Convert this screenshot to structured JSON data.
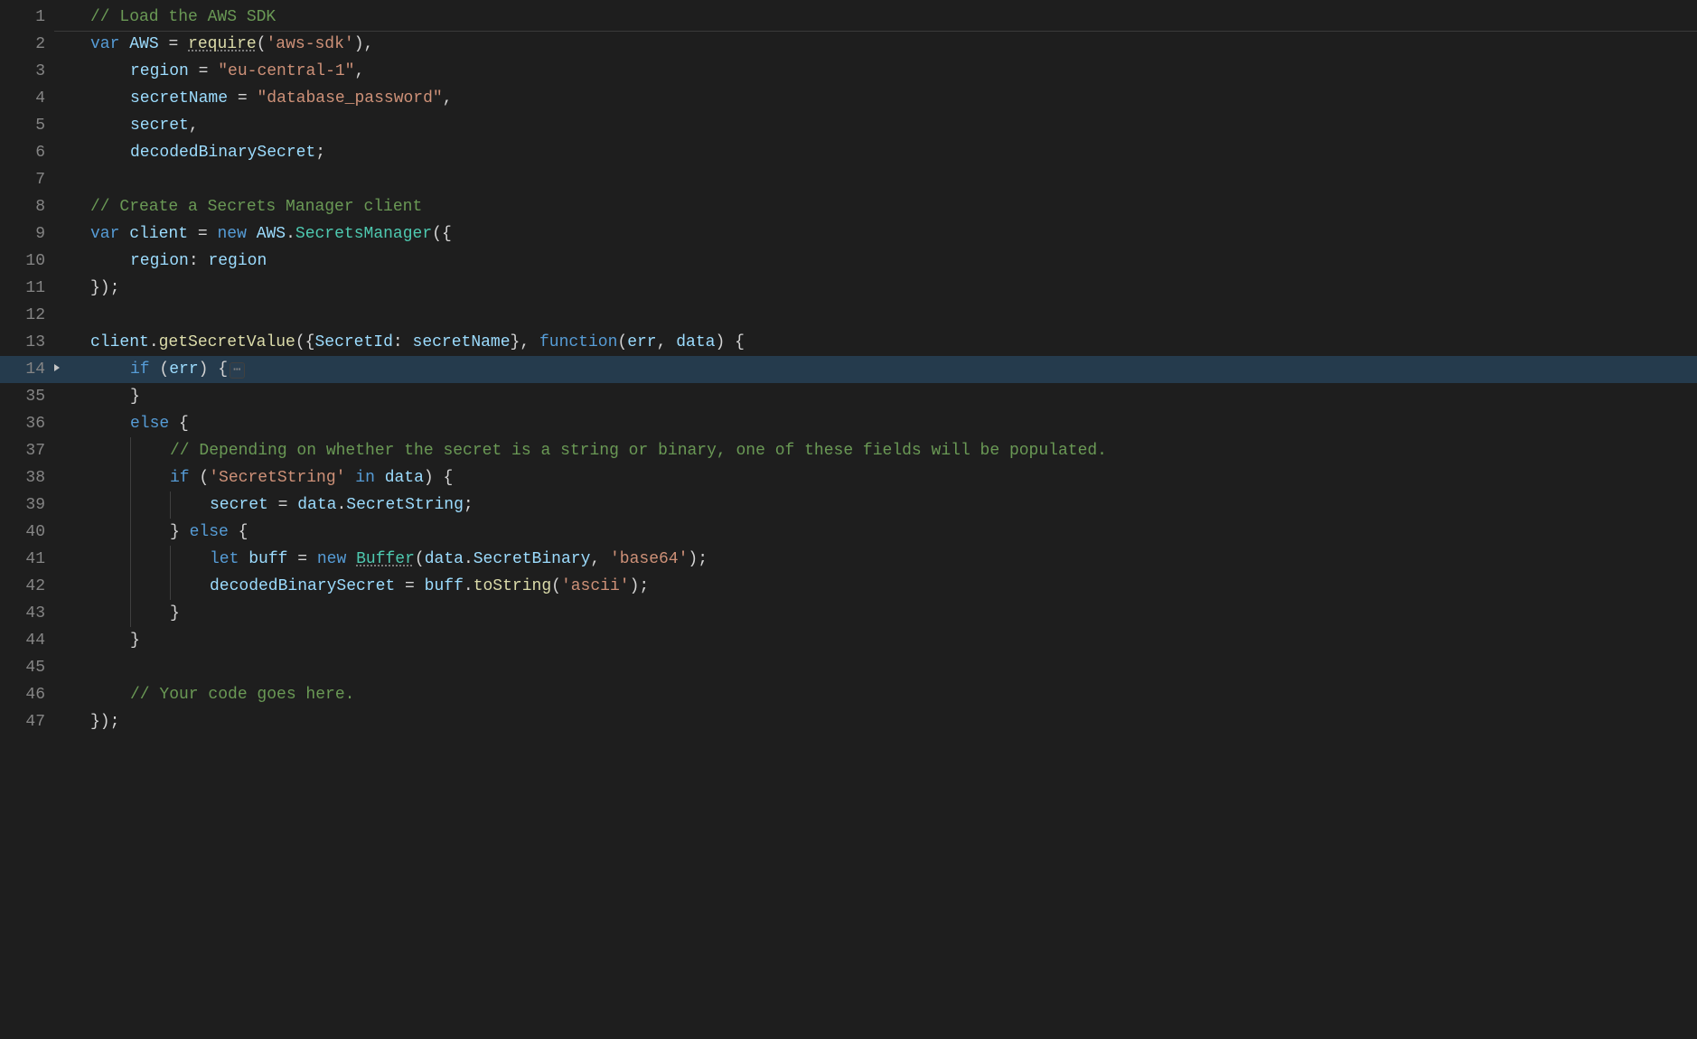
{
  "editor": {
    "highlighted_line_display_number": "14",
    "fold_icon_line_display_number": "14",
    "lines": [
      {
        "n": "1",
        "indent": 0,
        "tokens": [
          {
            "c": "tok-comment",
            "t": "// Load the AWS SDK"
          }
        ]
      },
      {
        "n": "2",
        "indent": 0,
        "tokens": [
          {
            "c": "tok-keyword",
            "t": "var"
          },
          {
            "c": "tok-def",
            "t": " "
          },
          {
            "c": "tok-var",
            "t": "AWS"
          },
          {
            "c": "tok-def",
            "t": " "
          },
          {
            "c": "tok-op",
            "t": "="
          },
          {
            "c": "tok-def",
            "t": " "
          },
          {
            "c": "tok-func underline",
            "t": "require"
          },
          {
            "c": "tok-punc",
            "t": "("
          },
          {
            "c": "tok-string",
            "t": "'aws-sdk'"
          },
          {
            "c": "tok-punc",
            "t": "),"
          }
        ]
      },
      {
        "n": "3",
        "indent": 1,
        "tokens": [
          {
            "c": "tok-var",
            "t": "region"
          },
          {
            "c": "tok-def",
            "t": " "
          },
          {
            "c": "tok-op",
            "t": "="
          },
          {
            "c": "tok-def",
            "t": " "
          },
          {
            "c": "tok-string",
            "t": "\"eu-central-1\""
          },
          {
            "c": "tok-punc",
            "t": ","
          }
        ]
      },
      {
        "n": "4",
        "indent": 1,
        "tokens": [
          {
            "c": "tok-var",
            "t": "secretName"
          },
          {
            "c": "tok-def",
            "t": " "
          },
          {
            "c": "tok-op",
            "t": "="
          },
          {
            "c": "tok-def",
            "t": " "
          },
          {
            "c": "tok-string",
            "t": "\"database_password\""
          },
          {
            "c": "tok-punc",
            "t": ","
          }
        ]
      },
      {
        "n": "5",
        "indent": 1,
        "tokens": [
          {
            "c": "tok-var",
            "t": "secret"
          },
          {
            "c": "tok-punc",
            "t": ","
          }
        ]
      },
      {
        "n": "6",
        "indent": 1,
        "tokens": [
          {
            "c": "tok-var",
            "t": "decodedBinarySecret"
          },
          {
            "c": "tok-punc",
            "t": ";"
          }
        ]
      },
      {
        "n": "7",
        "indent": 0,
        "tokens": []
      },
      {
        "n": "8",
        "indent": 0,
        "tokens": [
          {
            "c": "tok-comment",
            "t": "// Create a Secrets Manager client"
          }
        ]
      },
      {
        "n": "9",
        "indent": 0,
        "tokens": [
          {
            "c": "tok-keyword",
            "t": "var"
          },
          {
            "c": "tok-def",
            "t": " "
          },
          {
            "c": "tok-var",
            "t": "client"
          },
          {
            "c": "tok-def",
            "t": " "
          },
          {
            "c": "tok-op",
            "t": "="
          },
          {
            "c": "tok-def",
            "t": " "
          },
          {
            "c": "tok-keyword",
            "t": "new"
          },
          {
            "c": "tok-def",
            "t": " "
          },
          {
            "c": "tok-var",
            "t": "AWS"
          },
          {
            "c": "tok-punc",
            "t": "."
          },
          {
            "c": "tok-class",
            "t": "SecretsManager"
          },
          {
            "c": "tok-punc",
            "t": "({"
          }
        ]
      },
      {
        "n": "10",
        "indent": 1,
        "tokens": [
          {
            "c": "tok-var",
            "t": "region"
          },
          {
            "c": "tok-punc",
            "t": ":"
          },
          {
            "c": "tok-def",
            "t": " "
          },
          {
            "c": "tok-var",
            "t": "region"
          }
        ]
      },
      {
        "n": "11",
        "indent": 0,
        "tokens": [
          {
            "c": "tok-punc",
            "t": "});"
          }
        ]
      },
      {
        "n": "12",
        "indent": 0,
        "tokens": []
      },
      {
        "n": "13",
        "indent": 0,
        "tokens": [
          {
            "c": "tok-var",
            "t": "client"
          },
          {
            "c": "tok-punc",
            "t": "."
          },
          {
            "c": "tok-func",
            "t": "getSecretValue"
          },
          {
            "c": "tok-punc",
            "t": "({"
          },
          {
            "c": "tok-var",
            "t": "SecretId"
          },
          {
            "c": "tok-punc",
            "t": ":"
          },
          {
            "c": "tok-def",
            "t": " "
          },
          {
            "c": "tok-var",
            "t": "secretName"
          },
          {
            "c": "tok-punc",
            "t": "},"
          },
          {
            "c": "tok-def",
            "t": " "
          },
          {
            "c": "tok-keyword",
            "t": "function"
          },
          {
            "c": "tok-punc",
            "t": "("
          },
          {
            "c": "tok-var",
            "t": "err"
          },
          {
            "c": "tok-punc",
            "t": ","
          },
          {
            "c": "tok-def",
            "t": " "
          },
          {
            "c": "tok-var",
            "t": "data"
          },
          {
            "c": "tok-punc",
            "t": ")"
          },
          {
            "c": "tok-def",
            "t": " "
          },
          {
            "c": "tok-punc",
            "t": "{"
          }
        ]
      },
      {
        "n": "14",
        "indent": 1,
        "folded": true,
        "tokens": [
          {
            "c": "tok-keyword",
            "t": "if"
          },
          {
            "c": "tok-def",
            "t": " "
          },
          {
            "c": "tok-punc",
            "t": "("
          },
          {
            "c": "tok-var",
            "t": "err"
          },
          {
            "c": "tok-punc",
            "t": ")"
          },
          {
            "c": "tok-def",
            "t": " "
          },
          {
            "c": "tok-punc",
            "t": "{"
          }
        ]
      },
      {
        "n": "35",
        "indent": 1,
        "tokens": [
          {
            "c": "tok-punc",
            "t": "}"
          }
        ]
      },
      {
        "n": "36",
        "indent": 1,
        "tokens": [
          {
            "c": "tok-keyword",
            "t": "else"
          },
          {
            "c": "tok-def",
            "t": " "
          },
          {
            "c": "tok-punc",
            "t": "{"
          }
        ]
      },
      {
        "n": "37",
        "indent": 2,
        "tokens": [
          {
            "c": "tok-comment",
            "t": "// Depending on whether the secret is a string or binary, one of these fields will be populated."
          }
        ]
      },
      {
        "n": "38",
        "indent": 2,
        "tokens": [
          {
            "c": "tok-keyword",
            "t": "if"
          },
          {
            "c": "tok-def",
            "t": " "
          },
          {
            "c": "tok-punc",
            "t": "("
          },
          {
            "c": "tok-string",
            "t": "'SecretString'"
          },
          {
            "c": "tok-def",
            "t": " "
          },
          {
            "c": "tok-keyword",
            "t": "in"
          },
          {
            "c": "tok-def",
            "t": " "
          },
          {
            "c": "tok-var",
            "t": "data"
          },
          {
            "c": "tok-punc",
            "t": ")"
          },
          {
            "c": "tok-def",
            "t": " "
          },
          {
            "c": "tok-punc",
            "t": "{"
          }
        ]
      },
      {
        "n": "39",
        "indent": 3,
        "tokens": [
          {
            "c": "tok-var",
            "t": "secret"
          },
          {
            "c": "tok-def",
            "t": " "
          },
          {
            "c": "tok-op",
            "t": "="
          },
          {
            "c": "tok-def",
            "t": " "
          },
          {
            "c": "tok-var",
            "t": "data"
          },
          {
            "c": "tok-punc",
            "t": "."
          },
          {
            "c": "tok-var",
            "t": "SecretString"
          },
          {
            "c": "tok-punc",
            "t": ";"
          }
        ]
      },
      {
        "n": "40",
        "indent": 2,
        "tokens": [
          {
            "c": "tok-punc",
            "t": "}"
          },
          {
            "c": "tok-def",
            "t": " "
          },
          {
            "c": "tok-keyword",
            "t": "else"
          },
          {
            "c": "tok-def",
            "t": " "
          },
          {
            "c": "tok-punc",
            "t": "{"
          }
        ]
      },
      {
        "n": "41",
        "indent": 3,
        "tokens": [
          {
            "c": "tok-keyword",
            "t": "let"
          },
          {
            "c": "tok-def",
            "t": " "
          },
          {
            "c": "tok-var",
            "t": "buff"
          },
          {
            "c": "tok-def",
            "t": " "
          },
          {
            "c": "tok-op",
            "t": "="
          },
          {
            "c": "tok-def",
            "t": " "
          },
          {
            "c": "tok-keyword",
            "t": "new"
          },
          {
            "c": "tok-def",
            "t": " "
          },
          {
            "c": "tok-class underline",
            "t": "Buffer"
          },
          {
            "c": "tok-punc",
            "t": "("
          },
          {
            "c": "tok-var",
            "t": "data"
          },
          {
            "c": "tok-punc",
            "t": "."
          },
          {
            "c": "tok-var",
            "t": "SecretBinary"
          },
          {
            "c": "tok-punc",
            "t": ","
          },
          {
            "c": "tok-def",
            "t": " "
          },
          {
            "c": "tok-string",
            "t": "'base64'"
          },
          {
            "c": "tok-punc",
            "t": ");"
          }
        ]
      },
      {
        "n": "42",
        "indent": 3,
        "tokens": [
          {
            "c": "tok-var",
            "t": "decodedBinarySecret"
          },
          {
            "c": "tok-def",
            "t": " "
          },
          {
            "c": "tok-op",
            "t": "="
          },
          {
            "c": "tok-def",
            "t": " "
          },
          {
            "c": "tok-var",
            "t": "buff"
          },
          {
            "c": "tok-punc",
            "t": "."
          },
          {
            "c": "tok-func",
            "t": "toString"
          },
          {
            "c": "tok-punc",
            "t": "("
          },
          {
            "c": "tok-string",
            "t": "'ascii'"
          },
          {
            "c": "tok-punc",
            "t": ");"
          }
        ]
      },
      {
        "n": "43",
        "indent": 2,
        "tokens": [
          {
            "c": "tok-punc",
            "t": "}"
          }
        ]
      },
      {
        "n": "44",
        "indent": 1,
        "tokens": [
          {
            "c": "tok-punc",
            "t": "}"
          }
        ]
      },
      {
        "n": "45",
        "indent": 0,
        "tokens": []
      },
      {
        "n": "46",
        "indent": 1,
        "tokens": [
          {
            "c": "tok-comment",
            "t": "// Your code goes here."
          }
        ]
      },
      {
        "n": "47",
        "indent": 0,
        "tokens": [
          {
            "c": "tok-punc",
            "t": "});"
          }
        ]
      }
    ],
    "fold_placeholder_text": "⋯"
  }
}
